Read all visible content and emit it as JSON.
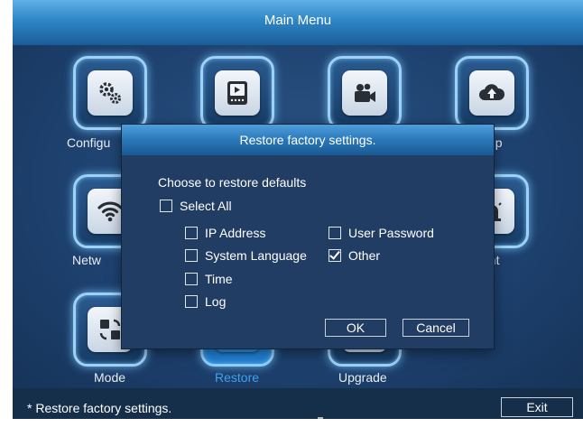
{
  "window": {
    "title": "Main Menu"
  },
  "menu_tiles": [
    {
      "label": "Configuration",
      "icon": "gears-icon"
    },
    {
      "label": "",
      "icon": "player-icon"
    },
    {
      "label": "",
      "icon": "camera-icon"
    },
    {
      "label": "Backup",
      "icon": "cloud-upload-icon"
    },
    {
      "label": "Network",
      "icon": "wifi-icon"
    },
    {
      "label": "Event",
      "icon": "alarm-icon"
    },
    {
      "label": "Mode",
      "icon": "mode-icon"
    },
    {
      "label": "Restore",
      "icon": "restore-icon",
      "active": true
    },
    {
      "label": "Upgrade",
      "icon": "upgrade-icon"
    }
  ],
  "visible_labels": {
    "configuration_partial": "Configu",
    "backup_partial": "kup",
    "network_partial": "Netw",
    "event_partial": "ent",
    "mode": "Mode",
    "restore": "Restore",
    "upgrade": "Upgrade"
  },
  "dialog": {
    "title": "Restore factory settings.",
    "heading": "Choose to restore defaults",
    "select_all": {
      "label": "Select All",
      "checked": false
    },
    "options": [
      {
        "label": "IP Address",
        "checked": false
      },
      {
        "label": "User Password",
        "checked": false
      },
      {
        "label": "System Language",
        "checked": false
      },
      {
        "label": "Other",
        "checked": true
      },
      {
        "label": "Time",
        "checked": false
      },
      {
        "label": "Log",
        "checked": false
      }
    ],
    "ok_label": "OK",
    "cancel_label": "Cancel"
  },
  "status": {
    "text": "*  Restore factory settings.",
    "exit_label": "Exit"
  },
  "colors": {
    "background": "#152e4a",
    "title_bar": "#2f86c6",
    "dialog_body": "#223d63",
    "active_label": "#3ea3f2",
    "tile_border": "#9fd0f5"
  }
}
